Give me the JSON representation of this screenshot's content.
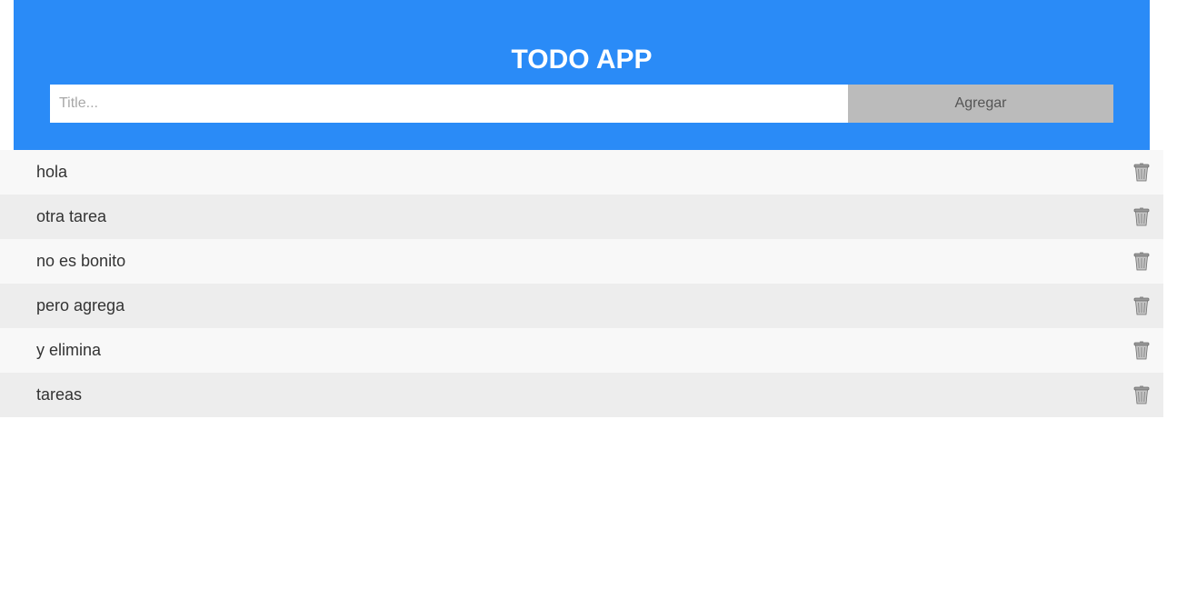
{
  "header": {
    "title": "TODO APP",
    "input_placeholder": "Title...",
    "input_value": "",
    "add_label": "Agregar",
    "background_color": "#2a8bf7"
  },
  "todos": [
    {
      "text": "hola",
      "icon": "trash-icon"
    },
    {
      "text": "otra tarea",
      "icon": "trash-icon"
    },
    {
      "text": "no es bonito",
      "icon": "trash-icon"
    },
    {
      "text": "pero agrega",
      "icon": "trash-icon"
    },
    {
      "text": "y elimina",
      "icon": "trash-icon"
    },
    {
      "text": "tareas",
      "icon": "trash-icon"
    }
  ]
}
